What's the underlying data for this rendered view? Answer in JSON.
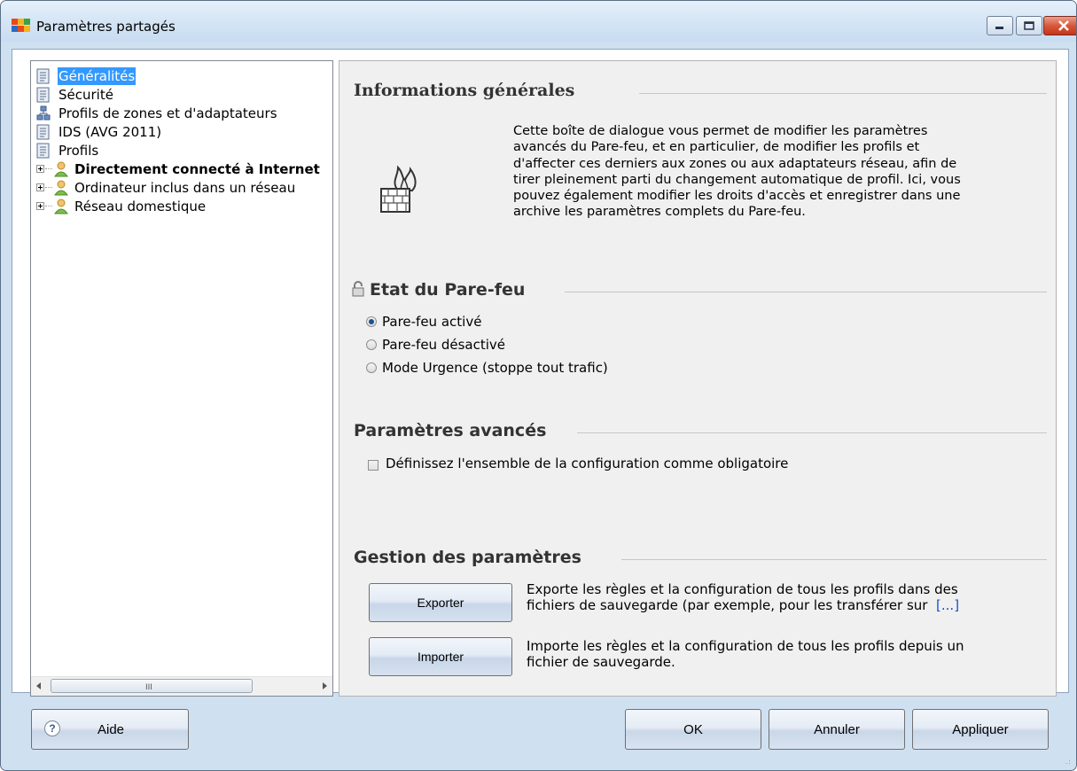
{
  "window": {
    "title": "Paramètres partagés",
    "controls": {
      "minimize": "minimize",
      "maximize": "maximize",
      "close": "close"
    }
  },
  "tree": {
    "items": [
      {
        "label": "Généralités",
        "icon": "document-icon",
        "selected": true
      },
      {
        "label": "Sécurité",
        "icon": "document-icon"
      },
      {
        "label": "Profils de zones et d'adaptateurs",
        "icon": "network-icon"
      },
      {
        "label": "IDS (AVG 2011)",
        "icon": "document-icon"
      },
      {
        "label": "Profils",
        "icon": "document-icon"
      },
      {
        "label": "Directement connecté à Internet",
        "icon": "user-icon",
        "bold": true
      },
      {
        "label": "Ordinateur inclus dans un réseau",
        "icon": "user-icon"
      },
      {
        "label": "Réseau domestique",
        "icon": "user-icon"
      }
    ],
    "scroll_grip": "III"
  },
  "sections": {
    "general": {
      "title": "Informations générales",
      "lines": [
        "Cette boîte de dialogue vous permet de modifier les paramètres",
        "avancés du Pare-feu, et en particulier, de modifier les profils et",
        "d'affecter ces derniers aux zones ou aux adaptateurs réseau, afin de",
        "tirer pleinement parti du changement automatique de profil. Ici, vous",
        "pouvez également modifier les droits d'accès et enregistrer dans une",
        "archive les paramètres complets du Pare-feu."
      ]
    },
    "firewall_state": {
      "title": "Etat du Pare-feu",
      "options": [
        {
          "label": "Pare-feu activé",
          "checked": true
        },
        {
          "label": "Pare-feu désactivé",
          "checked": false
        },
        {
          "label": "Mode Urgence (stoppe tout trafic)",
          "checked": false
        }
      ]
    },
    "advanced": {
      "title": "Paramètres avancés",
      "checkbox_label": "Définissez l'ensemble de la configuration comme obligatoire",
      "checked": false
    },
    "management": {
      "title": "Gestion des paramètres",
      "export": {
        "button": "Exporter",
        "line1": "Exporte les règles et la configuration de tous les profils dans des",
        "line2": "fichiers de sauvegarde (par exemple, pour les transférer sur",
        "more": "[...]"
      },
      "import": {
        "button": "Importer",
        "line1": "Importe les règles et la configuration de tous les profils depuis un",
        "line2": "fichier de sauvegarde."
      }
    }
  },
  "footer": {
    "help": "Aide",
    "help_icon": "?",
    "ok": "OK",
    "cancel": "Annuler",
    "apply": "Appliquer"
  },
  "colors": {
    "selection": "#3399ff",
    "window_frame": "#cfe0f1",
    "close_button": "#c4361b",
    "link": "#1a4ec7"
  }
}
